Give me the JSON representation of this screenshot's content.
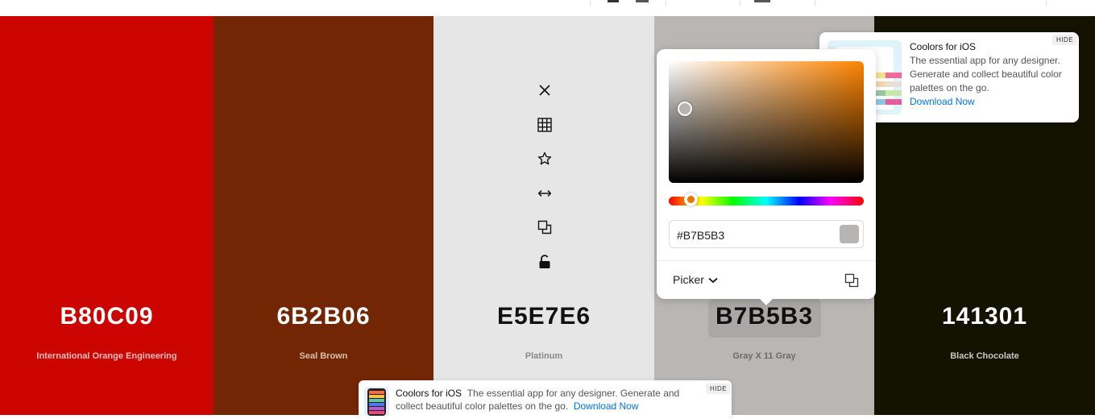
{
  "swatches": [
    {
      "hex": "B80C09",
      "name": "International Orange Engineering",
      "bg": "#cc0400",
      "text": "#ffffff",
      "name_color": "#f5c0bf",
      "width": 265
    },
    {
      "hex": "6B2B06",
      "name": "Seal Brown",
      "bg": "#732603",
      "text": "#ffffff",
      "name_color": "#dbbfb0",
      "width": 273
    },
    {
      "hex": "E5E7E6",
      "name": "Platinum",
      "bg": "#e5e6e5",
      "text": "#111111",
      "name_color": "#8a8a8a",
      "width": 274
    },
    {
      "hex": "B7B5B3",
      "name": "Gray X 11 Gray",
      "bg": "#b9b6b3",
      "text": "#111111",
      "name_color": "#6e6b69",
      "width": 273
    },
    {
      "hex": "141301",
      "name": "Black Chocolate",
      "bg": "#141300",
      "text": "#ffffff",
      "name_color": "#c8c8c0",
      "width": 274
    }
  ],
  "toolbar_icons": [
    "close-icon",
    "grid-icon",
    "star-icon",
    "drag-icon",
    "copy-icon",
    "unlock-icon"
  ],
  "picker": {
    "hex_value": "#B7B5B3",
    "mode_label": "Picker",
    "preview_color": "#B7B5B3"
  },
  "ad_top": {
    "title": "Coolors for iOS",
    "body": "The essential app for any designer. Generate and collect beautiful color palettes on the go.",
    "link": "Download Now",
    "hide": "HIDE"
  },
  "ad_bottom": {
    "title": "Coolors for iOS",
    "body": "The essential app for any designer. Generate and collect beautiful color palettes on the go.",
    "link": "Download Now",
    "hide": "HIDE"
  }
}
